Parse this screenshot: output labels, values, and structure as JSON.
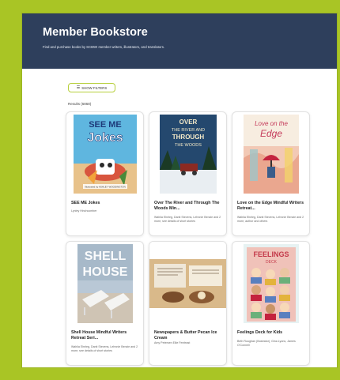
{
  "header": {
    "title": "Member Bookstore",
    "subtitle": "Find and purchase books by SCBWI member writers, illustrators, and translators."
  },
  "filter_button": {
    "label": "SHOW FILTERS"
  },
  "results_label": "Results (6868)",
  "books": [
    {
      "title": "SEE ME Jokes",
      "authors": "Lynley Hinchcomber",
      "cover_text": [
        "SEE ME",
        "Jokes"
      ],
      "cover_small": "Illustrated by ASHLEY WOODINGTON"
    },
    {
      "title": "Over The River and Through The Woods Min...",
      "authors": "Wahlia Eheleg, Danit Stevens, Lehnnie Benzie and 2 more, see details of short stories",
      "cover_text": [
        "OVER",
        "THE RIVER AND",
        "THROUGH",
        "THE WOODS"
      ]
    },
    {
      "title": "Love on the Edge Mindful Writers Retreat...",
      "authors": "Wahlia Eheleg, Danit Stevens, Lehnnie Benzie and 2 more, author and others",
      "cover_text": [
        "Love on the",
        "Edge"
      ]
    },
    {
      "title": "Shell House Mindful Writers Retreat Seri...",
      "authors": "Wahlia Eheleg, Danit Stevens, Lehnnie Benzie and 2 more, see details of short stories",
      "cover_text": [
        "SHELL",
        "HOUSE"
      ]
    },
    {
      "title": "Newspapers & Butter Pecan Ice Cream",
      "authors": "Amy Petersen Ellie Fenfeast"
    },
    {
      "title": "Feelings Deck for Kids",
      "authors": "Beth Roughan (Illustrator), Gina Lyons, James O'Connell",
      "cover_text": [
        "FEELINGS",
        "DECK"
      ]
    }
  ],
  "colors": {
    "frame": "#a9c525",
    "header_bg": "#2e3f5c",
    "filter_border": "#b6cf3a"
  }
}
